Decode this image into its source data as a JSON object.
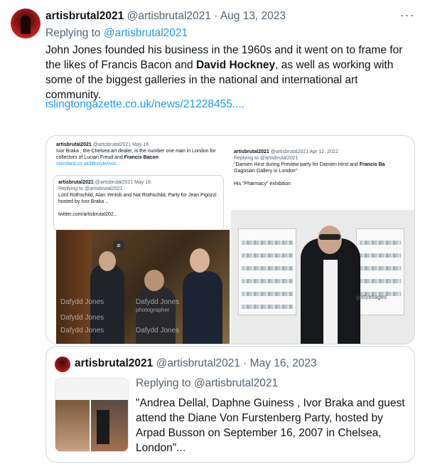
{
  "tweet": {
    "display_name": "artisbrutal2021",
    "handle": "@artisbrutal2021",
    "separator": "·",
    "date": "Aug 13, 2023",
    "more_icon": "more-horizontal-icon",
    "replying_prefix": "Replying to ",
    "replying_handle": "@artisbrutal2021",
    "body_part1": "John Jones founded his business in the 1960s and it went on to frame for the likes of Francis Bacon and ",
    "body_bold": "David Hockney",
    "body_part2": ", as well as working with some of the biggest galleries in the national and international art community.",
    "link": "islingtongazette.co.uk/news/21228455...."
  },
  "quoted_images": {
    "left": {
      "name": "artisbrutal2021",
      "handle": "@artisbrutal2021",
      "date": "May 16",
      "text_part1": "Ivor Braka , the Chelsea art dealer, is the number one man in London for collectors of Lucian Freud and ",
      "text_bold": "Francis Bacon",
      "link": "standard.co.uk/lifestyle/ivor...",
      "inner": {
        "name": "artisbrutal2021",
        "handle": "@artisbrutal2021",
        "date": "May 16",
        "replying": "Replying to @artisbrutal2021",
        "text": "Lord Rothschild, Alan Yentob and Nat Rothschild, Party for Jean Pigozzi hosted by Ivor Braka ..",
        "link": "twitter.com/artisbrutal202..."
      },
      "watermark": "Dafydd Jones",
      "watermark_sub": "photographer",
      "menu_badge": "≡"
    },
    "right": {
      "name": "artisbrutal2021",
      "handle": "@artisbrutal2021",
      "date": "Apr 12, 2022",
      "replying": "Replying to @artisbrutal2021",
      "text_part1": "\"Damien Hirst during Preview party for Damien Hirst and ",
      "text_bold": "Francis Ba",
      "text_part2": "Gagosian Gallery in London\"",
      "text_line2": "His \"Pharmacy\" exhibition",
      "getty": "gettyimages"
    }
  },
  "quoted_tweet": {
    "display_name": "artisbrutal2021",
    "handle": "@artisbrutal2021",
    "separator": "·",
    "date": "May 16, 2023",
    "replying": "Replying to @artisbrutal2021",
    "text": "\"Andrea Dellal, Daphne Guiness , Ivor Braka and guest attend the Diane Von  Furstenberg Party, hosted by Arpad Busson on September 16, 2007 in  Chelsea, London\"..."
  }
}
